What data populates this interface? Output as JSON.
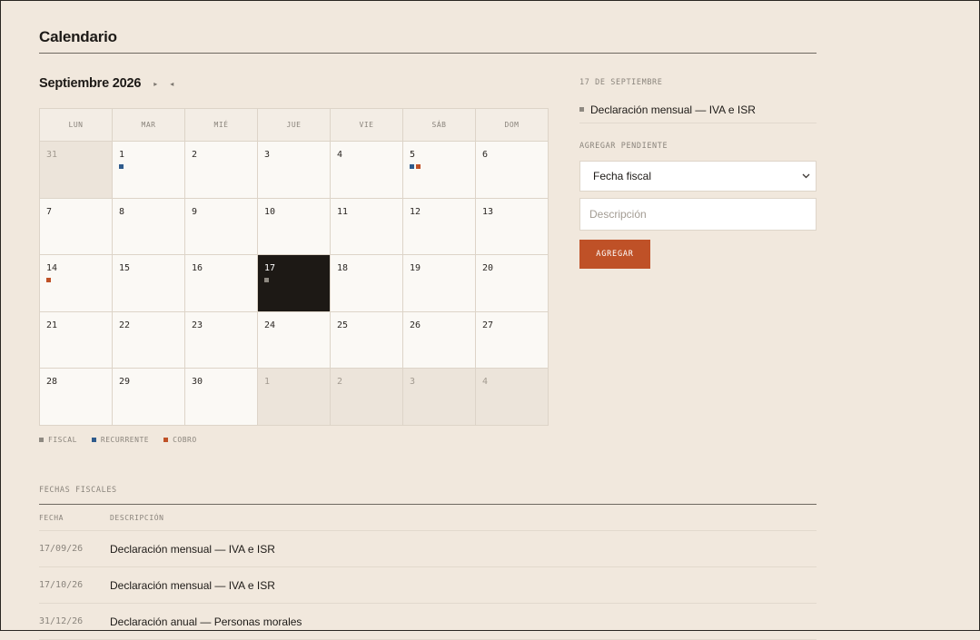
{
  "page": {
    "title": "Calendario"
  },
  "calendar": {
    "month_label": "Septiembre 2026",
    "next_icon": "▸",
    "prev_icon": "◂",
    "weekdays": [
      "LUN",
      "MAR",
      "MIÉ",
      "JUE",
      "VIE",
      "SÁB",
      "DOM"
    ],
    "weeks": [
      [
        {
          "day": "31",
          "out": true,
          "dots": []
        },
        {
          "day": "1",
          "out": false,
          "dots": [
            "recurrente"
          ]
        },
        {
          "day": "2",
          "out": false,
          "dots": []
        },
        {
          "day": "3",
          "out": false,
          "dots": []
        },
        {
          "day": "4",
          "out": false,
          "dots": []
        },
        {
          "day": "5",
          "out": false,
          "dots": [
            "recurrente",
            "cobro"
          ]
        },
        {
          "day": "6",
          "out": false,
          "dots": []
        }
      ],
      [
        {
          "day": "7",
          "out": false,
          "dots": []
        },
        {
          "day": "8",
          "out": false,
          "dots": []
        },
        {
          "day": "9",
          "out": false,
          "dots": []
        },
        {
          "day": "10",
          "out": false,
          "dots": []
        },
        {
          "day": "11",
          "out": false,
          "dots": []
        },
        {
          "day": "12",
          "out": false,
          "dots": []
        },
        {
          "day": "13",
          "out": false,
          "dots": []
        }
      ],
      [
        {
          "day": "14",
          "out": false,
          "dots": [
            "cobro"
          ]
        },
        {
          "day": "15",
          "out": false,
          "dots": []
        },
        {
          "day": "16",
          "out": false,
          "dots": []
        },
        {
          "day": "17",
          "out": false,
          "selected": true,
          "dots": [
            "fiscal"
          ]
        },
        {
          "day": "18",
          "out": false,
          "dots": []
        },
        {
          "day": "19",
          "out": false,
          "dots": []
        },
        {
          "day": "20",
          "out": false,
          "dots": []
        }
      ],
      [
        {
          "day": "21",
          "out": false,
          "dots": []
        },
        {
          "day": "22",
          "out": false,
          "dots": []
        },
        {
          "day": "23",
          "out": false,
          "dots": []
        },
        {
          "day": "24",
          "out": false,
          "dots": []
        },
        {
          "day": "25",
          "out": false,
          "dots": []
        },
        {
          "day": "26",
          "out": false,
          "dots": []
        },
        {
          "day": "27",
          "out": false,
          "dots": []
        }
      ],
      [
        {
          "day": "28",
          "out": false,
          "dots": []
        },
        {
          "day": "29",
          "out": false,
          "dots": []
        },
        {
          "day": "30",
          "out": false,
          "dots": []
        },
        {
          "day": "1",
          "out": true,
          "dots": []
        },
        {
          "day": "2",
          "out": true,
          "dots": []
        },
        {
          "day": "3",
          "out": true,
          "dots": []
        },
        {
          "day": "4",
          "out": true,
          "dots": []
        }
      ]
    ]
  },
  "legend": {
    "fiscal": "FISCAL",
    "recurrente": "RECURRENTE",
    "cobro": "COBRO"
  },
  "colors": {
    "fiscal": "#8e8981",
    "recurrente": "#2f5b8c",
    "cobro": "#bf5127",
    "selected_bg": "#1d1915"
  },
  "sidebar": {
    "selected_date": "17 DE SEPTIEMBRE",
    "event": {
      "type": "fiscal",
      "text": "Declaración mensual — IVA e ISR"
    },
    "add_label": "AGREGAR PENDIENTE",
    "select_value": "Fecha fiscal",
    "description_placeholder": "Descripción",
    "add_button": "AGREGAR"
  },
  "fiscal_dates": {
    "label": "FECHAS FISCALES",
    "headers": {
      "date": "FECHA",
      "description": "DESCRIPCIÓN"
    },
    "rows": [
      {
        "date": "17/09/26",
        "description": "Declaración mensual — IVA e ISR"
      },
      {
        "date": "17/10/26",
        "description": "Declaración mensual — IVA e ISR"
      },
      {
        "date": "31/12/26",
        "description": "Declaración anual — Personas morales"
      }
    ]
  }
}
